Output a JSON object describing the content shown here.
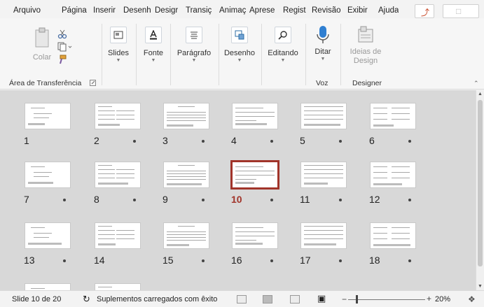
{
  "menu": {
    "tabs": [
      {
        "label": "Arquivo",
        "active": false
      },
      {
        "label": "Página",
        "active": true
      },
      {
        "label": "Inserir",
        "active": false
      },
      {
        "label": "Desenh",
        "active": false
      },
      {
        "label": "Desigr",
        "active": false
      },
      {
        "label": "Transiç",
        "active": false
      },
      {
        "label": "Animaç",
        "active": false
      },
      {
        "label": "Aprese",
        "active": false
      },
      {
        "label": "Regist",
        "active": false
      },
      {
        "label": "Revisão",
        "active": false
      },
      {
        "label": "Exibir",
        "active": false
      },
      {
        "label": "Ajuda",
        "active": false
      }
    ],
    "share_icon": "share-icon",
    "comment_icon": "comment-icon"
  },
  "ribbon": {
    "paste_label": "Colar",
    "slides_label": "Slides",
    "font_label": "Fonte",
    "paragraph_label": "Parágrafo",
    "drawing_label": "Desenho",
    "editing_label": "Editando",
    "dictate_label": "Ditar",
    "designer_line1": "Ideias de",
    "designer_line2": "Design",
    "groups": {
      "clipboard": "Área de Transferência",
      "voice": "Voz",
      "designer": "Designer"
    }
  },
  "slides": {
    "count": 20,
    "selected": 10,
    "visible_numbers": [
      "1",
      "2",
      "3",
      "4",
      "5",
      "6",
      "7",
      "8",
      "9",
      "10",
      "11",
      "12",
      "13",
      "14",
      "15",
      "16",
      "17",
      "18"
    ]
  },
  "status": {
    "slide_info": "Slide 10 de 20",
    "addins": "Suplementos carregados com êxito",
    "zoom": "20%",
    "zoom_level": 0.1
  },
  "colors": {
    "accent": "#c43e1c",
    "selection": "#a1342a",
    "sorter_bg": "#d8d8d8"
  }
}
